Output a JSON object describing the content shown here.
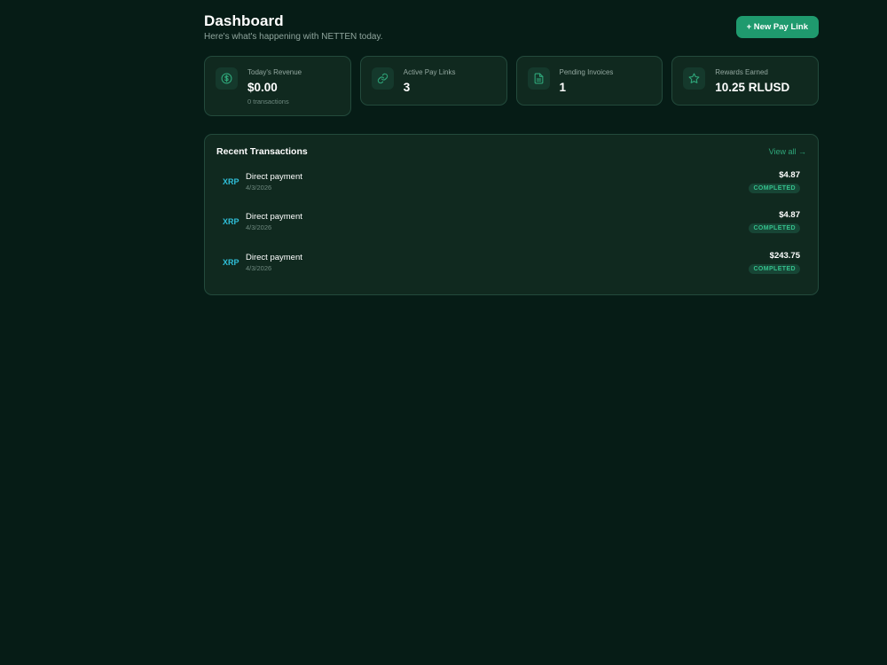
{
  "header": {
    "title": "Dashboard",
    "subtitle": "Here's what's happening with NETTEN today.",
    "new_button": "+ New Pay Link"
  },
  "stats": [
    {
      "icon": "dollar-icon",
      "label": "Today's Revenue",
      "value": "$0.00",
      "sub": "0 transactions"
    },
    {
      "icon": "link-icon",
      "label": "Active Pay Links",
      "value": "3"
    },
    {
      "icon": "document-icon",
      "label": "Pending Invoices",
      "value": "1"
    },
    {
      "icon": "star-icon",
      "label": "Rewards Earned",
      "value": "10.25 RLUSD"
    }
  ],
  "transactions": {
    "title": "Recent Transactions",
    "view_all": "View all →",
    "items": [
      {
        "coin": "XRP",
        "name": "Direct payment",
        "date": "4/3/2026",
        "amount": "$4.87",
        "status": "COMPLETED"
      },
      {
        "coin": "XRP",
        "name": "Direct payment",
        "date": "4/3/2026",
        "amount": "$4.87",
        "status": "COMPLETED"
      },
      {
        "coin": "XRP",
        "name": "Direct payment",
        "date": "4/3/2026",
        "amount": "$243.75",
        "status": "COMPLETED"
      }
    ]
  },
  "colors": {
    "background": "#061c16",
    "card": "#10291f",
    "accent": "#1f9a6e",
    "coin": "#2fbfd9",
    "status": "#34c08c"
  }
}
